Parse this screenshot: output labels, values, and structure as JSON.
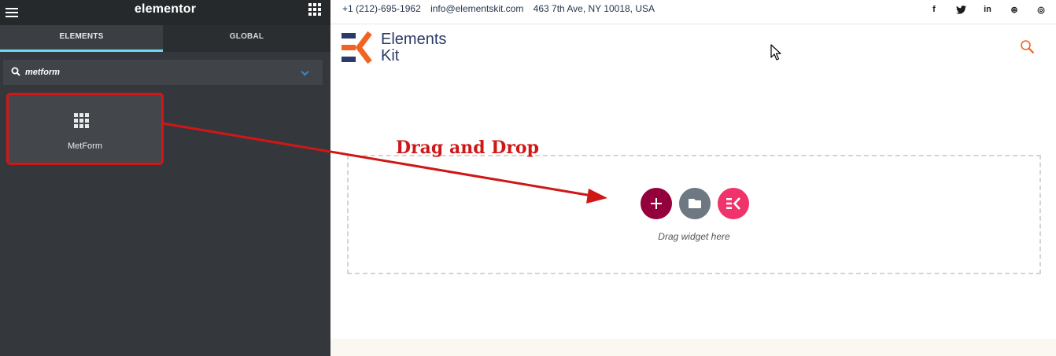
{
  "editor": {
    "brand": "elementor",
    "tabs": [
      {
        "label": "ELEMENTS",
        "active": true
      },
      {
        "label": "GLOBAL",
        "active": false
      }
    ],
    "search": {
      "value": "metform"
    },
    "widgets": [
      {
        "label": "MetForm",
        "icon": "grid-icon"
      }
    ]
  },
  "page": {
    "contact": {
      "phone": "+1 (212)-695-1962",
      "email": "info@elementskit.com",
      "address": "463 7th Ave, NY 10018, USA"
    },
    "social": [
      {
        "icon": "facebook-icon",
        "glyph": "f"
      },
      {
        "icon": "twitter-icon",
        "glyph": "t"
      },
      {
        "icon": "linkedin-icon",
        "glyph": "in"
      },
      {
        "icon": "dribbble-icon",
        "glyph": "⊛"
      },
      {
        "icon": "instagram-icon",
        "glyph": "◎"
      }
    ],
    "logo": {
      "line1": "Elements",
      "line2": "Kit"
    },
    "dropzone": {
      "hint": "Drag widget here"
    }
  },
  "annotation": {
    "text": "Drag and Drop"
  },
  "colors": {
    "sidebar_bg": "#34383c",
    "tab_active_underline": "#71d7f7",
    "add_button": "#93003c",
    "folder_button": "#6d7882",
    "ek_button": "#f0336b",
    "logo_orange": "#f26322",
    "logo_navy": "#2b3a68",
    "annotation_red": "#cf1717"
  }
}
